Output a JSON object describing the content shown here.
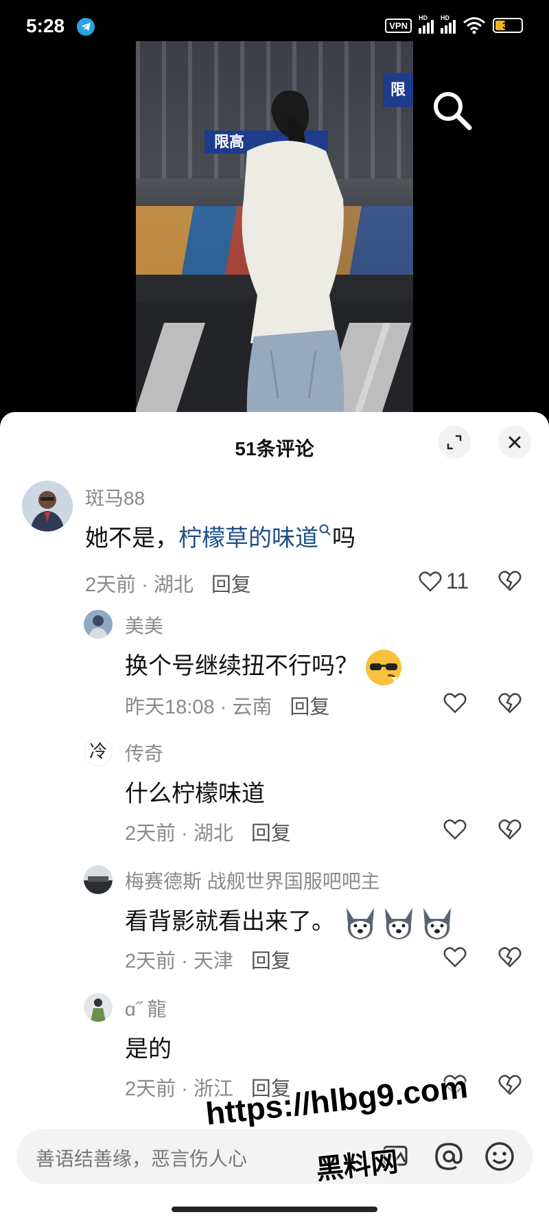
{
  "status_bar": {
    "time": "5:28",
    "vpn": "VPN",
    "hd1": "HD",
    "hd2": "HD",
    "battery": "39",
    "battery_level": 0.39
  },
  "video": {
    "sign_left": "限高",
    "sign_right": "限"
  },
  "comments_panel": {
    "title": "51条评论",
    "comments": [
      {
        "user": "斑马88",
        "text_plain": "她不是，",
        "text_link": "柠檬草的味道",
        "text_after": "吗",
        "time": "2天前 · 湖北",
        "reply": "回复",
        "likes": "11"
      },
      {
        "user": "美美",
        "text": "换个号继续扭不行吗？",
        "time": "昨天18:08 · 云南",
        "reply": "回复"
      },
      {
        "user": "传奇",
        "avatar_char": "冷",
        "text": "什么柠檬味道",
        "time": "2天前 · 湖北",
        "reply": "回复"
      },
      {
        "user": "梅赛德斯 战舰世界国服吧吧主",
        "text": "看背影就看出来了。",
        "time": "2天前 · 天津",
        "reply": "回复"
      },
      {
        "user": "ɑ˝ 龍",
        "text": "是的",
        "time": "2天前 · 浙江",
        "reply": "回复"
      }
    ]
  },
  "input": {
    "placeholder": "善语结善缘，恶言伤人心"
  },
  "watermark": {
    "url": "https://hlbg9.com",
    "name": "黑料网"
  },
  "colors": {
    "link": "#1d4f8a",
    "meta": "#8a8a8a",
    "battery": "#f0b429",
    "telegram": "#2aa3e0"
  }
}
